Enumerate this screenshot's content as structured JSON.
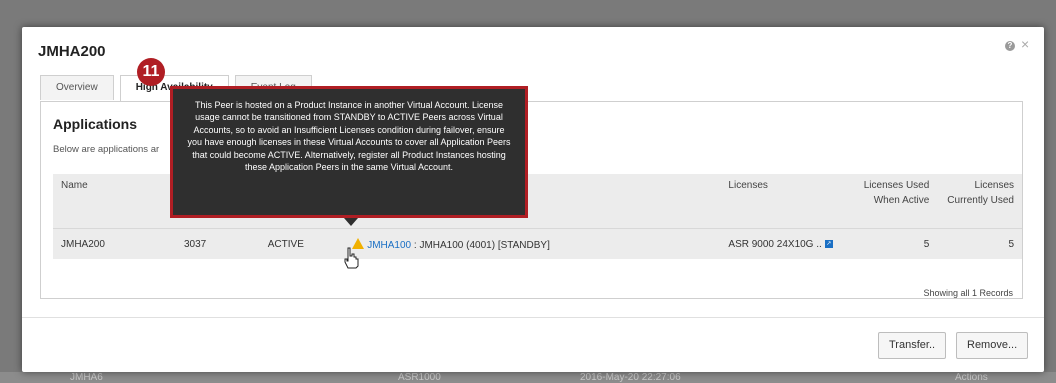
{
  "modal": {
    "title": "JMHA200",
    "help_icon": "help-icon",
    "close_icon": "×"
  },
  "tabs": [
    {
      "label": "Overview",
      "active": false
    },
    {
      "label": "High Availability",
      "active": true
    },
    {
      "label": "Event Log",
      "active": false
    }
  ],
  "panel": {
    "title": "Applications",
    "subtitle": "Below are applications ar"
  },
  "table": {
    "columns": [
      "Name",
      "",
      "",
      "",
      "Licenses",
      "Licenses Used When Active",
      "Licenses Currently Used"
    ],
    "rows": [
      {
        "name": "JMHA200",
        "id": "3037",
        "status": "ACTIVE",
        "peer_link": "JMHA100",
        "peer_detail": " : JMHA100 (4001) [STANDBY]",
        "licenses": "ASR 9000 24X10G ..",
        "used_when_active": "5",
        "currently_used": "5"
      }
    ],
    "records_text": "Showing all 1 Records"
  },
  "footer": {
    "transfer_label": "Transfer..",
    "remove_label": "Remove..."
  },
  "tooltip": {
    "text": "This Peer is hosted on a Product Instance in another Virtual Account. License usage cannot be transitioned from STANDBY to ACTIVE Peers across Virtual Accounts, so to avoid an Insufficient Licenses condition during failover, ensure you have enough licenses in these Virtual Accounts to cover all Application Peers that could become ACTIVE. Alternatively, register all Product Instances hosting these Application Peers in the same Virtual Account."
  },
  "step_badge": "11",
  "background_row": {
    "name": "JMHA6",
    "device": "ASR1000",
    "date": "2016-May-20 22:27:06",
    "action": "Actions"
  },
  "colors": {
    "accent_red": "#b01e24",
    "link_blue": "#1a6fc4",
    "warning": "#f0b000"
  }
}
